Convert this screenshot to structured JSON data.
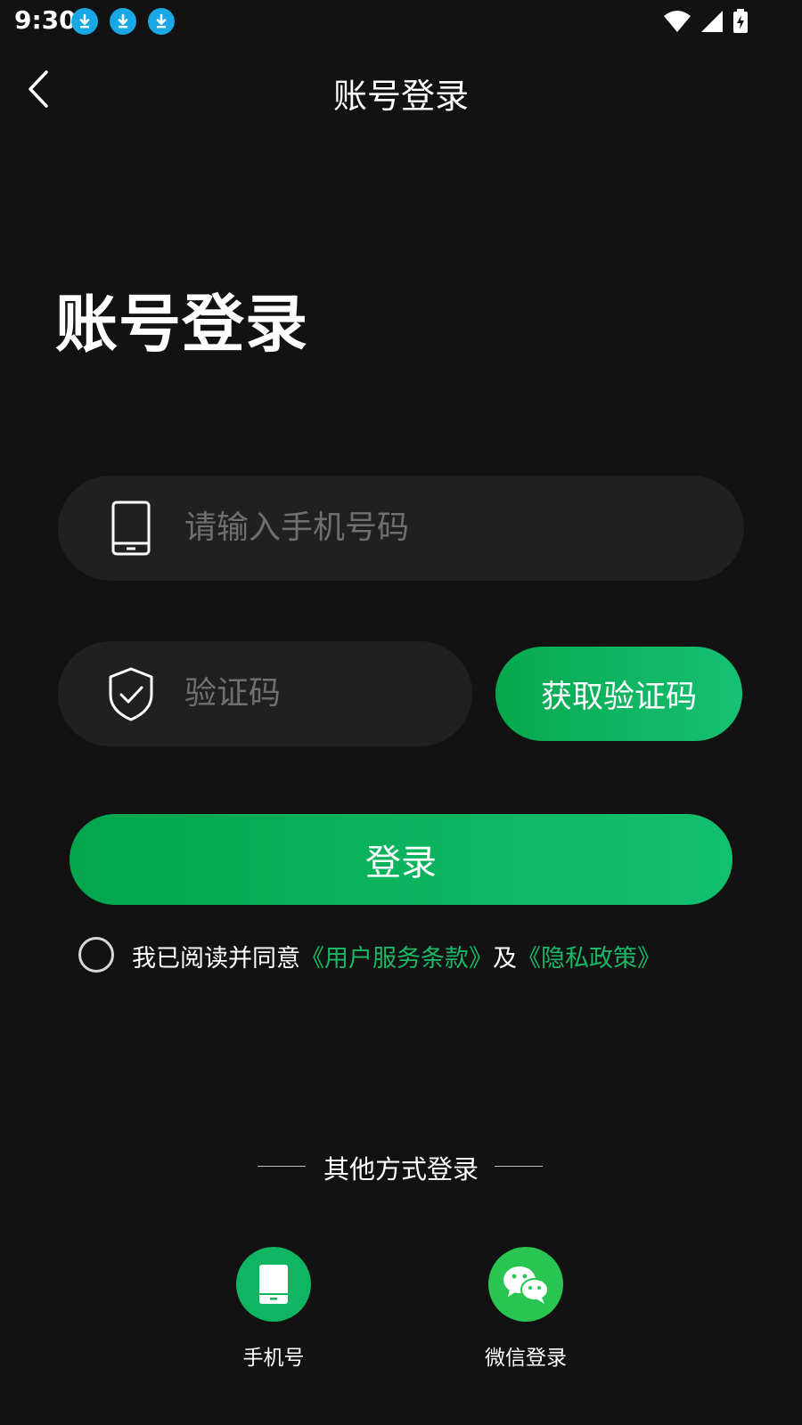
{
  "status_bar": {
    "time": "9:30"
  },
  "header": {
    "title": "账号登录"
  },
  "main": {
    "big_title": "账号登录",
    "phone_placeholder": "请输入手机号码",
    "code_placeholder": "验证码",
    "get_code_label": "获取验证码",
    "login_label": "登录"
  },
  "agreement": {
    "prefix": "我已阅读并同意",
    "terms": "《用户服务条款》",
    "and": "及",
    "privacy": "《隐私政策》"
  },
  "other_login": {
    "title": "其他方式登录",
    "options": [
      {
        "label": "手机号",
        "icon": "phone-icon"
      },
      {
        "label": "微信登录",
        "icon": "wechat-icon"
      }
    ]
  },
  "colors": {
    "background": "#121212",
    "accent": "#0cb35e",
    "field": "#202020",
    "link": "#18b866"
  }
}
